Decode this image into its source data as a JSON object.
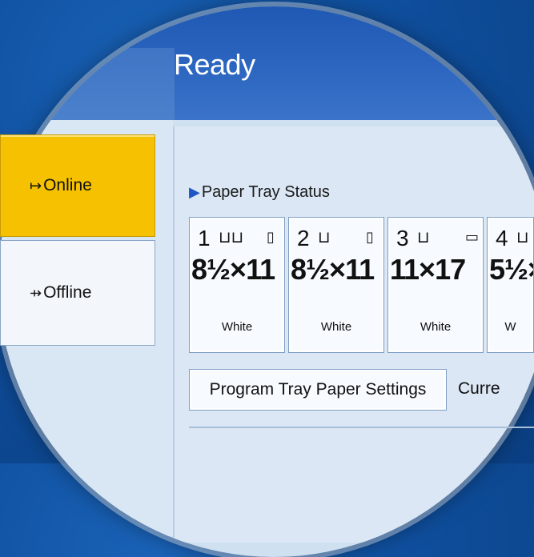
{
  "header": {
    "title": "Ready"
  },
  "modes": {
    "online": {
      "label": "Online",
      "icon": "online-arrow-icon"
    },
    "offline": {
      "label": "Offline",
      "icon": "offline-arrow-icon"
    }
  },
  "paper_tray": {
    "section_title": "Paper Tray Status",
    "trays": [
      {
        "number": "1",
        "feed_icon": "tray-lcf-icon",
        "orientation_icon": "portrait-paper-icon",
        "size": "8½×11",
        "color": "White"
      },
      {
        "number": "2",
        "feed_icon": "tray-icon",
        "orientation_icon": "portrait-paper-icon",
        "size": "8½×11",
        "color": "White"
      },
      {
        "number": "3",
        "feed_icon": "tray-icon",
        "orientation_icon": "landscape-paper-icon",
        "size": "11×17",
        "color": "White"
      },
      {
        "number": "4",
        "feed_icon": "tray-icon",
        "orientation_icon": "",
        "size": "5½×",
        "color": "W"
      }
    ]
  },
  "buttons": {
    "program_tray": "Program Tray Paper Settings"
  },
  "status_text": "Curre",
  "colors": {
    "online_active": "#f5c100",
    "header_blue": "#2c66c0",
    "background_blue": "#0f4f9e"
  }
}
